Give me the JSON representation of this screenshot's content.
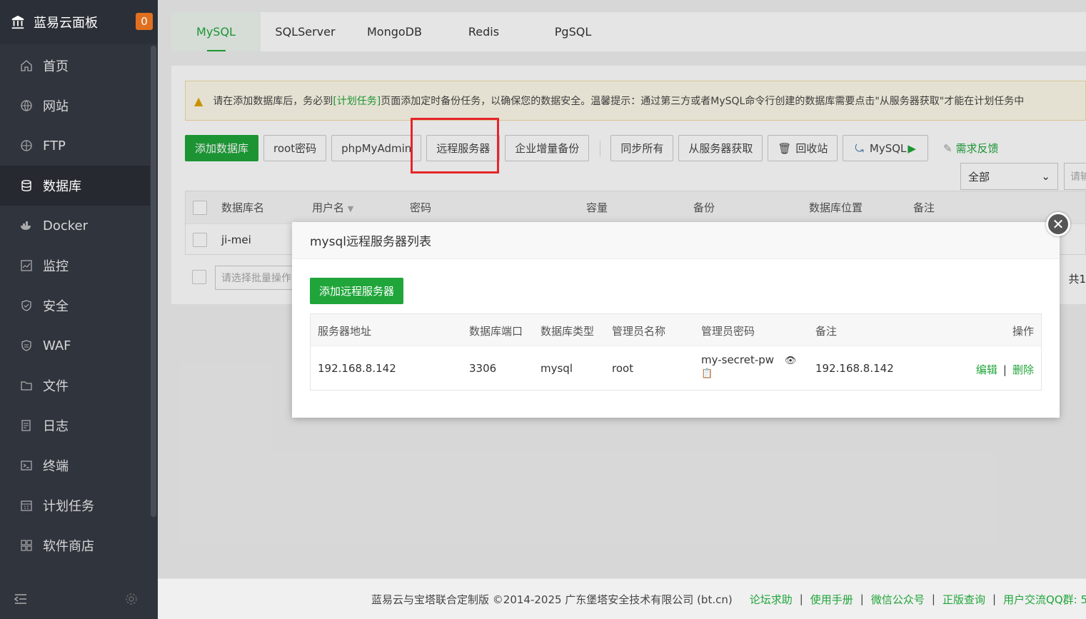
{
  "sidebar": {
    "brand": "蓝易云面板",
    "badge": "0",
    "items": [
      {
        "label": "首页",
        "icon": "home-icon"
      },
      {
        "label": "网站",
        "icon": "globe-icon"
      },
      {
        "label": "FTP",
        "icon": "ftp-icon"
      },
      {
        "label": "数据库",
        "icon": "database-icon"
      },
      {
        "label": "Docker",
        "icon": "docker-icon"
      },
      {
        "label": "监控",
        "icon": "monitor-icon"
      },
      {
        "label": "安全",
        "icon": "shield-icon"
      },
      {
        "label": "WAF",
        "icon": "waf-icon"
      },
      {
        "label": "文件",
        "icon": "folder-icon"
      },
      {
        "label": "日志",
        "icon": "log-icon"
      },
      {
        "label": "终端",
        "icon": "terminal-icon"
      },
      {
        "label": "计划任务",
        "icon": "calendar-icon"
      },
      {
        "label": "软件商店",
        "icon": "apps-icon"
      }
    ],
    "active_index": 3
  },
  "tabs": [
    "MySQL",
    "SQLServer",
    "MongoDB",
    "Redis",
    "PgSQL"
  ],
  "warning": {
    "before": "请在添加数据库后，务必到",
    "link": "[计划任务]",
    "after": "页面添加定时备份任务，以确保您的数据安全。温馨提示：通过第三方或者MySQL命令行创建的数据库需要点击\"从服务器获取\"才能在计划任务中"
  },
  "toolbar": {
    "add_db": "添加数据库",
    "root_pw": "root密码",
    "phpmyadmin": "phpMyAdmin",
    "remote": "远程服务器",
    "enterprise_backup": "企业增量备份",
    "sync_all": "同步所有",
    "fetch": "从服务器获取",
    "recycle": "回收站",
    "mysql": "MySQL",
    "feedback": "需求反馈",
    "filter_value": "全部",
    "search_placeholder": "请输"
  },
  "db_table": {
    "headers": [
      "数据库名",
      "用户名",
      "密码",
      "容量",
      "备份",
      "数据库位置",
      "备注"
    ],
    "rows": [
      {
        "name": "ji-mei"
      }
    ]
  },
  "bulk": {
    "placeholder": "请选择批量操作",
    "total": "共1"
  },
  "modal": {
    "title": "mysql远程服务器列表",
    "add_button": "添加远程服务器",
    "headers": [
      "服务器地址",
      "数据库端口",
      "数据库类型",
      "管理员名称",
      "管理员密码",
      "备注",
      "操作"
    ],
    "rows": [
      {
        "address": "192.168.8.142",
        "port": "3306",
        "type": "mysql",
        "admin": "root",
        "password": "my-secret-pw",
        "note": "192.168.8.142",
        "edit": "编辑",
        "delete": "删除"
      }
    ]
  },
  "footer": {
    "copyright": "蓝易云与宝塔联合定制版 ©2014-2025 广东堡塔安全技术有限公司 (bt.cn)",
    "links": [
      "论坛求助",
      "使用手册",
      "微信公众号",
      "正版查询",
      "用户交流QQ群: 5"
    ]
  },
  "colors": {
    "accent": "#20a53a",
    "sidebar": "#30343d",
    "badge": "#e0701f",
    "highlight": "#e6262b"
  }
}
